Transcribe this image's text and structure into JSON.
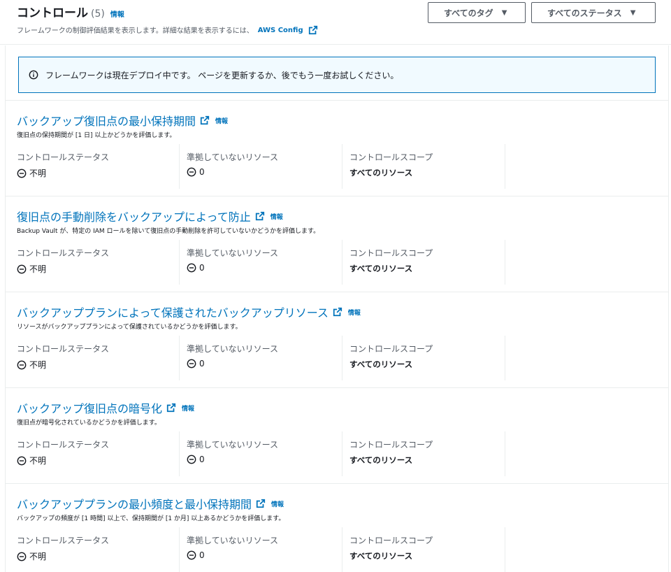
{
  "header": {
    "title": "コントロール",
    "count": "(5)",
    "info": "情報",
    "description": "フレームワークの制御評価結果を表示します。詳細な結果を表示するには、",
    "link": "AWS Config"
  },
  "filters": {
    "tags": "すべてのタグ",
    "status": "すべてのステータス"
  },
  "alert": {
    "message": "フレームワークは現在デプロイ中です。 ページを更新するか、後でもう一度お試しください。"
  },
  "labels": {
    "status": "コントロールステータス",
    "noncompliant": "準拠していないリソース",
    "scope": "コントロールスコープ",
    "info": "情報"
  },
  "controls": [
    {
      "title": "バックアップ復旧点の最小保持期間",
      "description": "復旧点の保持期間が [1 日] 以上かどうかを評価します。",
      "status": "不明",
      "noncompliant": "0",
      "scope": "すべてのリソース"
    },
    {
      "title": "復旧点の手動削除をバックアップによって防止",
      "description": "Backup Vault が、特定の IAM ロールを除いて復旧点の手動削除を許可していないかどうかを評価します。",
      "status": "不明",
      "noncompliant": "0",
      "scope": "すべてのリソース"
    },
    {
      "title": "バックアッププランによって保護されたバックアップリソース",
      "description": "リソースがバックアッププランによって保護されているかどうかを評価します。",
      "status": "不明",
      "noncompliant": "0",
      "scope": "すべてのリソース"
    },
    {
      "title": "バックアップ復旧点の暗号化",
      "description": "復旧点が暗号化されているかどうかを評価します。",
      "status": "不明",
      "noncompliant": "0",
      "scope": "すべてのリソース"
    },
    {
      "title": "バックアッププランの最小頻度と最小保持期間",
      "description": "バックアップの頻度が [1 時間] 以上で、保持期間が [1 か月] 以上あるかどうかを評価します。",
      "status": "不明",
      "noncompliant": "0",
      "scope": "すべてのリソース"
    }
  ]
}
